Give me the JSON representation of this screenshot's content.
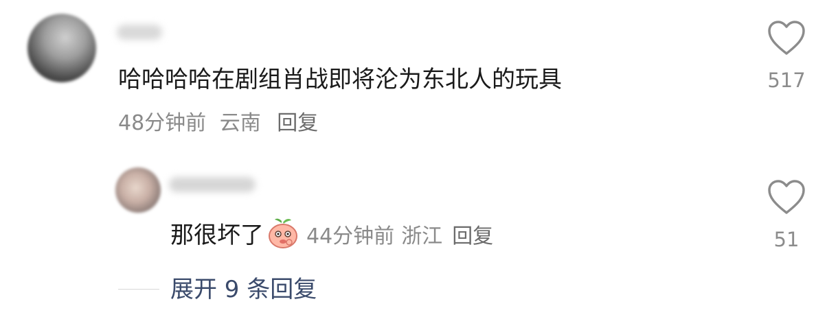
{
  "comment": {
    "text": "哈哈哈哈在剧组肖战即将沦为东北人的玩具",
    "time": "48分钟前",
    "location": "云南",
    "reply_label": "回复",
    "likes": "517"
  },
  "reply": {
    "text": "那很坏了",
    "emoji": "peach-face-emoji",
    "time": "44分钟前",
    "location": "浙江",
    "reply_label": "回复",
    "likes": "51"
  },
  "expand_label": "展开 9 条回复",
  "icons": {
    "like": "heart-outline-icon"
  },
  "colors": {
    "text": "#1a1a1a",
    "meta": "#8a8a8a",
    "link": "#3a4a6b"
  }
}
